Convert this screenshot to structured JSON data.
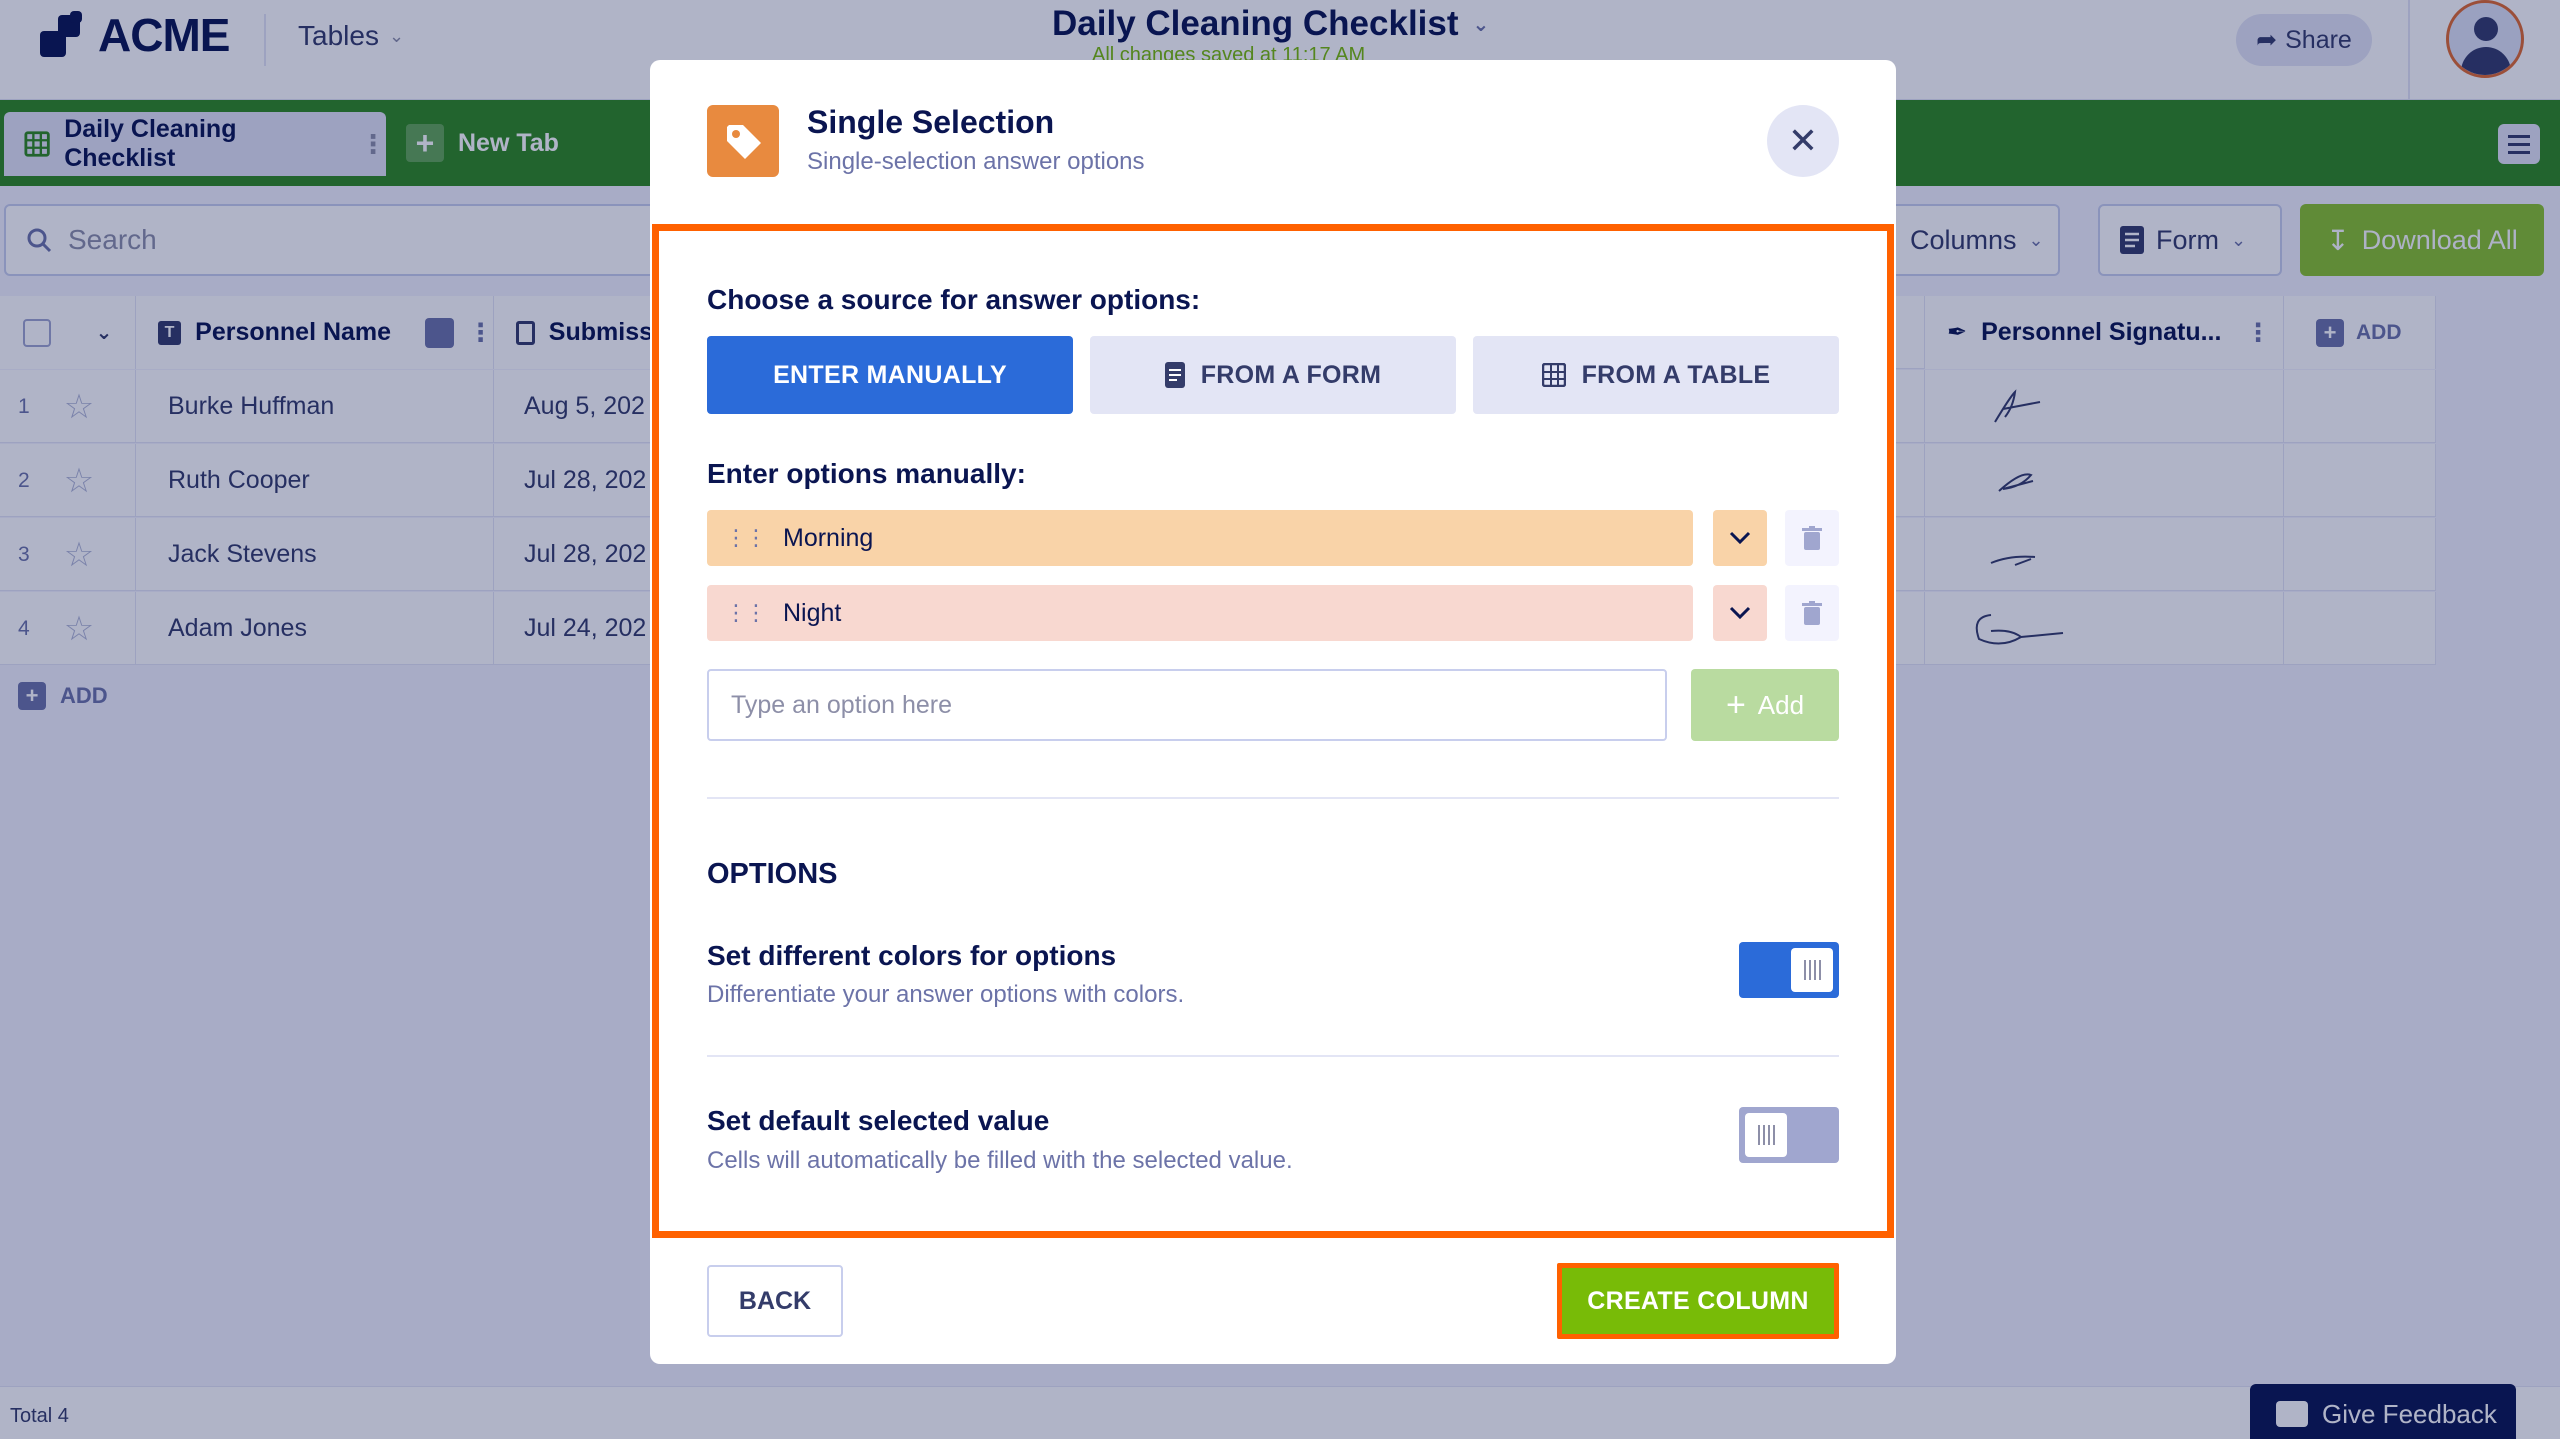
{
  "app": {
    "logo_text": "ACME",
    "tables_menu": "Tables",
    "doc_title": "Daily Cleaning Checklist",
    "saved_status": "All changes saved at 11:17 AM",
    "share_label": "Share"
  },
  "tabs": {
    "active_label": "Daily Cleaning Checklist",
    "new_tab_label": "New Tab"
  },
  "toolbar": {
    "search_placeholder": "Search",
    "columns_label": "Columns",
    "form_label": "Form",
    "download_label": "Download All"
  },
  "table": {
    "columns": [
      "Personnel Name",
      "Submiss",
      "Personnel Signatu...",
      "ADD"
    ],
    "rows": [
      {
        "num": "1",
        "name": "Burke Huffman",
        "date": "Aug 5, 202"
      },
      {
        "num": "2",
        "name": "Ruth Cooper",
        "date": "Jul 28, 202"
      },
      {
        "num": "3",
        "name": "Jack Stevens",
        "date": "Jul 28, 202"
      },
      {
        "num": "4",
        "name": "Adam Jones",
        "date": "Jul 24, 202"
      }
    ],
    "add_row_label": "ADD",
    "total_label": "Total 4"
  },
  "feedback_label": "Give Feedback",
  "modal": {
    "title": "Single Selection",
    "subtitle": "Single-selection answer options",
    "source_label": "Choose a source for answer options:",
    "sources": [
      "ENTER MANUALLY",
      "FROM A FORM",
      "FROM A TABLE"
    ],
    "manual_label": "Enter options manually:",
    "options": [
      {
        "label": "Morning",
        "color": "#f9d3a8"
      },
      {
        "label": "Night",
        "color": "#f8d8d0"
      }
    ],
    "input_placeholder": "Type an option here",
    "add_label": "Add",
    "options_heading": "OPTIONS",
    "settings": [
      {
        "title": "Set different colors for options",
        "desc": "Differentiate your answer options with colors.",
        "enabled": true
      },
      {
        "title": "Set default selected value",
        "desc": "Cells will automatically be filled with the selected value.",
        "enabled": false
      }
    ],
    "back_label": "BACK",
    "create_label": "CREATE COLUMN"
  }
}
